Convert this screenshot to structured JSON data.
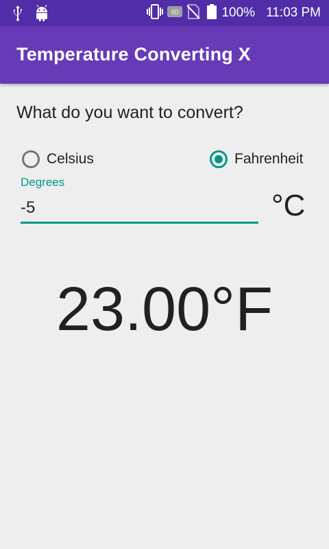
{
  "status_bar": {
    "battery_text": "100%",
    "time": "11:03 PM",
    "icons": [
      "usb-icon",
      "android-icon",
      "vibrate-icon",
      "sd-card-icon",
      "no-sim-icon",
      "battery-icon"
    ],
    "sd_label": "SD"
  },
  "app_bar": {
    "title": "Temperature Converting X"
  },
  "form": {
    "question": "What do you want to convert?",
    "options": [
      {
        "label": "Celsius",
        "checked": false
      },
      {
        "label": "Fahrenheit",
        "checked": true
      }
    ],
    "field_label": "Degrees",
    "value": "-5",
    "unit": "°C"
  },
  "result": {
    "text": "23.00°F"
  },
  "colors": {
    "status_bar": "#512da8",
    "app_bar": "#673ab7",
    "accent": "#009688",
    "background": "#eeeeee"
  }
}
